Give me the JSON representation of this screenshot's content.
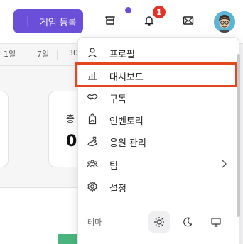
{
  "header": {
    "register_button": "게임 등록",
    "notification_count": "1"
  },
  "periods": [
    "1일",
    "7일",
    "30"
  ],
  "cards": [
    {
      "label": "총",
      "value": "0"
    }
  ],
  "menu": {
    "items": [
      {
        "label": "프로필",
        "icon": "user-icon"
      },
      {
        "label": "대시보드",
        "icon": "bar-chart-icon"
      },
      {
        "label": "구독",
        "icon": "handshake-icon"
      },
      {
        "label": "인벤토리",
        "icon": "backpack-icon"
      },
      {
        "label": "응원 관리",
        "icon": "cheer-icon"
      },
      {
        "label": "팀",
        "icon": "team-icon"
      },
      {
        "label": "설정",
        "icon": "gear-icon"
      }
    ],
    "theme_label": "테마",
    "highlight_color": "#e4471f"
  },
  "colors": {
    "accent": "#6b4fd8",
    "badge": "#e5332a"
  }
}
